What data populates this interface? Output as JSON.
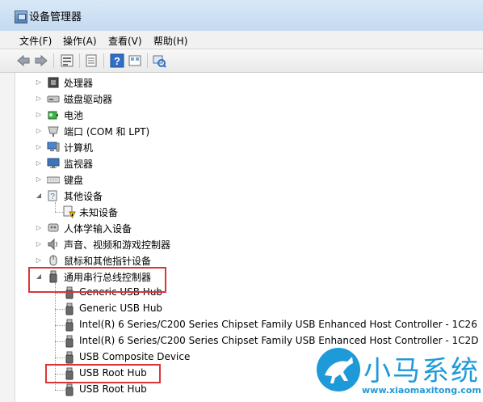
{
  "window": {
    "title": "设备管理器"
  },
  "menu": [
    "文件(F)",
    "操作(A)",
    "查看(V)",
    "帮助(H)"
  ],
  "toolbar": {
    "buttons": [
      "back-arrow-icon",
      "forward-arrow-icon",
      "properties-icon",
      "list-icon",
      "help-icon",
      "view-icon",
      "scan-hardware-icon"
    ]
  },
  "tree": [
    {
      "label": "处理器",
      "toggle": "▷",
      "icon": "processor-icon"
    },
    {
      "label": "磁盘驱动器",
      "toggle": "▷",
      "icon": "disk-drive-icon"
    },
    {
      "label": "电池",
      "toggle": "▷",
      "icon": "battery-icon"
    },
    {
      "label": "端口 (COM 和 LPT)",
      "toggle": "▷",
      "icon": "port-icon"
    },
    {
      "label": "计算机",
      "toggle": "▷",
      "icon": "computer-icon"
    },
    {
      "label": "监视器",
      "toggle": "▷",
      "icon": "monitor-icon"
    },
    {
      "label": "键盘",
      "toggle": "▷",
      "icon": "keyboard-icon"
    },
    {
      "label": "其他设备",
      "toggle": "◢",
      "icon": "other-devices-icon"
    },
    {
      "label": "未知设备",
      "toggle": "",
      "icon": "unknown-device-warning-icon"
    },
    {
      "label": "人体学输入设备",
      "toggle": "▷",
      "icon": "hid-icon"
    },
    {
      "label": "声音、视频和游戏控制器",
      "toggle": "▷",
      "icon": "sound-icon"
    },
    {
      "label": "鼠标和其他指针设备",
      "toggle": "▷",
      "icon": "mouse-icon"
    },
    {
      "label": "通用串行总线控制器",
      "toggle": "◢",
      "icon": "usb-controller-icon"
    },
    {
      "label": "Generic USB Hub",
      "toggle": "",
      "icon": "usb-device-icon"
    },
    {
      "label": "Generic USB Hub",
      "toggle": "",
      "icon": "usb-device-icon"
    },
    {
      "label": "Intel(R) 6 Series/C200 Series Chipset Family USB Enhanced Host Controller - 1C26",
      "toggle": "",
      "icon": "usb-device-icon"
    },
    {
      "label": "Intel(R) 6 Series/C200 Series Chipset Family USB Enhanced Host Controller - 1C2D",
      "toggle": "",
      "icon": "usb-device-icon"
    },
    {
      "label": "USB Composite Device",
      "toggle": "",
      "icon": "usb-device-icon"
    },
    {
      "label": "USB Root Hub",
      "toggle": "",
      "icon": "usb-device-icon"
    },
    {
      "label": "USB Root Hub",
      "toggle": "",
      "icon": "usb-device-icon"
    }
  ],
  "watermark": {
    "brand": "小马系统",
    "url": "www.xiaomaxitong.com"
  },
  "colors": {
    "highlight": "#d9363b",
    "watermark": "#1f9ad8"
  }
}
